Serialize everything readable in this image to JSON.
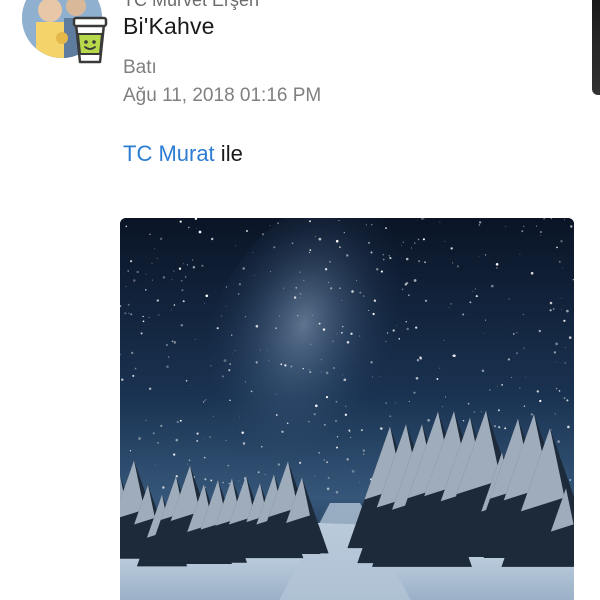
{
  "checkin": {
    "top_cut_text": "TC Mürvet Erşen",
    "venue_name": "Bi'Kahve",
    "location": "Batı",
    "timestamp": "Ağu 11, 2018 01:16 PM",
    "with_friend": "TC Murat",
    "with_suffix": " ile"
  },
  "icons": {
    "avatar": "user-avatar-photo",
    "coffee": "coffee-cup-icon"
  },
  "colors": {
    "link": "#2d7dd2",
    "text": "#1a1a1a",
    "muted": "#808080"
  }
}
